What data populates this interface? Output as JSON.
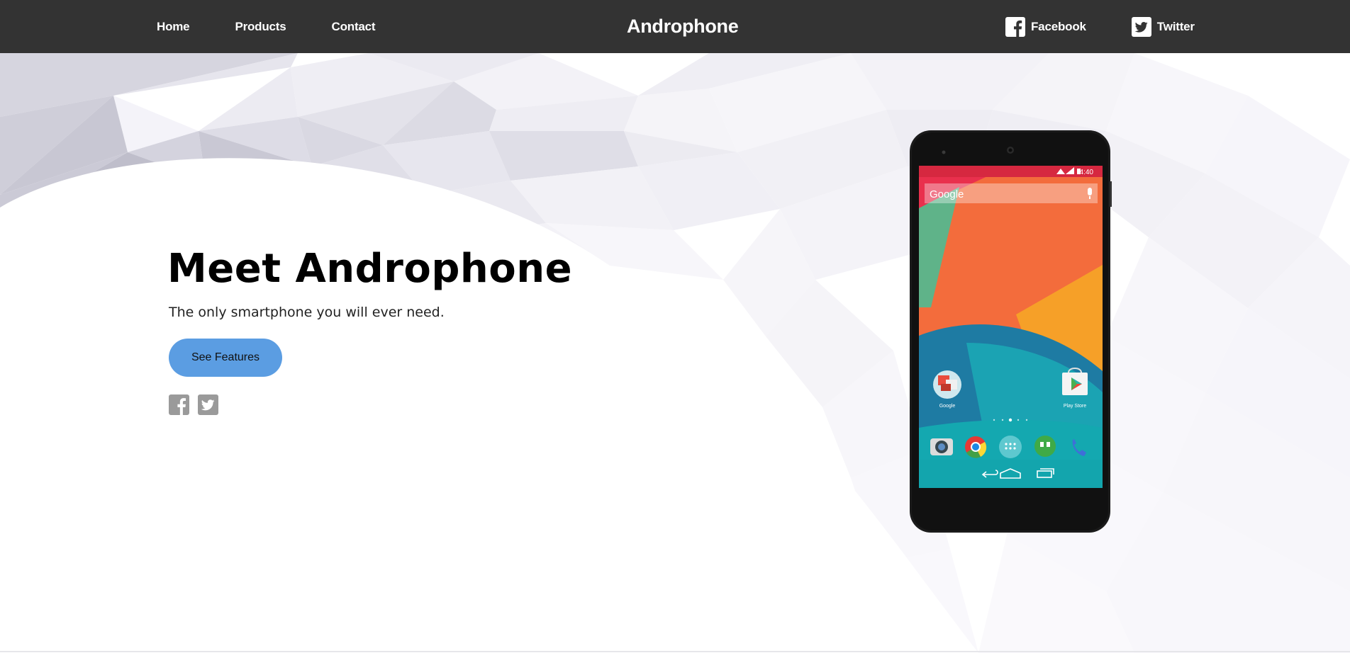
{
  "navbar": {
    "links": [
      "Home",
      "Products",
      "Contact"
    ],
    "brand": "Androphone",
    "social": [
      {
        "label": "Facebook",
        "icon": "facebook-icon"
      },
      {
        "label": "Twitter",
        "icon": "twitter-icon"
      }
    ]
  },
  "hero": {
    "title": "Meet Androphone",
    "subtitle": "The only smartphone you will ever need.",
    "cta_label": "See Features",
    "social_icons": [
      "facebook-icon",
      "twitter-icon"
    ]
  },
  "phone_screen": {
    "status_time": "4:40",
    "search_label": "Google",
    "app_google_label": "Google",
    "app_playstore_label": "Play Store",
    "dock_icons": [
      "camera-icon",
      "chrome-icon",
      "app-drawer-icon",
      "hangouts-icon",
      "phone-icon"
    ]
  },
  "colors": {
    "navbar_bg": "#333333",
    "cta_bg": "#5b9de2",
    "icon_gray": "#9a9a9a"
  }
}
